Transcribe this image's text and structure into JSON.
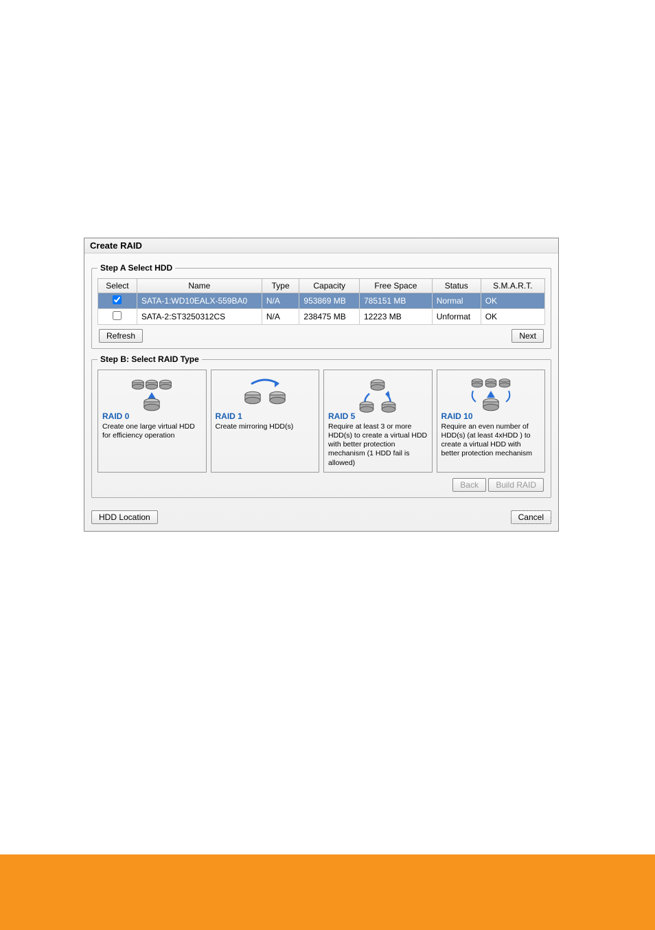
{
  "dialog": {
    "title": "Create RAID"
  },
  "step_a": {
    "legend": "Step A Select HDD",
    "headers": {
      "select": "Select",
      "name": "Name",
      "type": "Type",
      "capacity": "Capacity",
      "free_space": "Free Space",
      "status": "Status",
      "smart": "S.M.A.R.T."
    },
    "rows": [
      {
        "checked": true,
        "selected": true,
        "name": "SATA-1:WD10EALX-559BA0",
        "type": "N/A",
        "capacity": "953869 MB",
        "free_space": "785151 MB",
        "status": "Normal",
        "smart": "OK"
      },
      {
        "checked": false,
        "selected": false,
        "name": "SATA-2:ST3250312CS",
        "type": "N/A",
        "capacity": "238475 MB",
        "free_space": "12223 MB",
        "status": "Unformat",
        "smart": "OK"
      }
    ],
    "refresh_btn": "Refresh",
    "next_btn": "Next"
  },
  "step_b": {
    "legend": "Step B: Select RAID Type",
    "options": [
      {
        "title": "RAID 0",
        "desc": "Create one large virtual HDD for efficiency operation"
      },
      {
        "title": "RAID 1",
        "desc": "Create mirroring HDD(s)"
      },
      {
        "title": "RAID 5",
        "desc": "Require at least 3 or more HDD(s)  to create a virtual HDD with better protection mechanism (1 HDD fail is allowed)"
      },
      {
        "title": "RAID 10",
        "desc": "Require an even number of HDD(s) (at least 4xHDD ) to create a virtual HDD with better protection mechanism"
      }
    ],
    "back_btn": "Back",
    "build_btn": "Build RAID"
  },
  "bottom": {
    "hdd_location_btn": "HDD Location",
    "cancel_btn": "Cancel"
  }
}
